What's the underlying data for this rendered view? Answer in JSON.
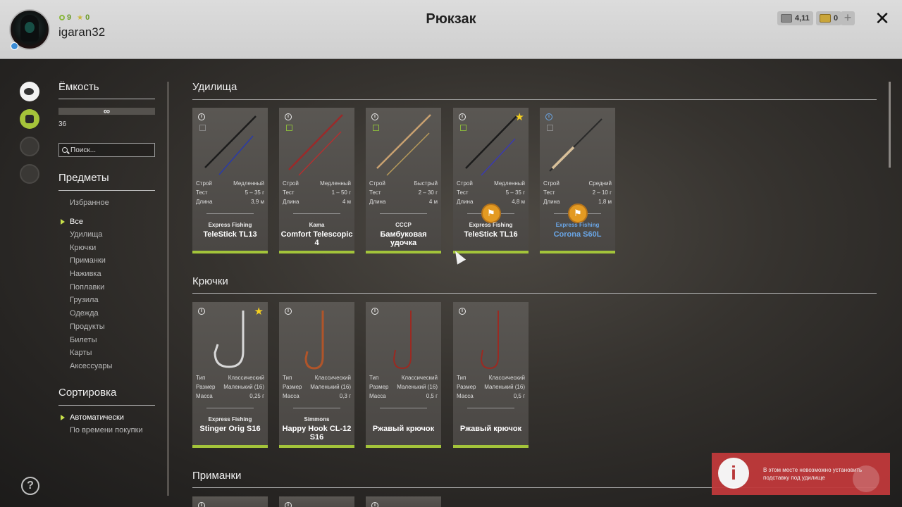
{
  "header": {
    "title": "Рюкзак",
    "username": "igaran32",
    "stat_level": "9",
    "stat_stars": "0",
    "silver": "4,11",
    "gold": "0",
    "add_label": "+",
    "close_label": "✕"
  },
  "sidebar": {
    "capacity_title": "Ёмкость",
    "capacity_value": "∞",
    "capacity_count": "36",
    "search_placeholder": "Поиск...",
    "items_title": "Предметы",
    "categories": [
      "Избранное",
      "Все",
      "Удилища",
      "Крючки",
      "Приманки",
      "Наживка",
      "Поплавки",
      "Грузила",
      "Одежда",
      "Продукты",
      "Билеты",
      "Карты",
      "Аксессуары"
    ],
    "active_category": "Все",
    "sort_title": "Сортировка",
    "sort_options": [
      "Автоматически",
      "По времени покупки"
    ],
    "active_sort": "Автоматически",
    "help_label": "?"
  },
  "sections": {
    "rods": {
      "title": "Удилища",
      "items": [
        {
          "brand": "Express Fishing",
          "name": "TeleStick TL13",
          "specs": [
            [
              "Строй",
              "Медленный"
            ],
            [
              "Тест",
              "5 – 35 г"
            ],
            [
              "Длина",
              "3,9 м"
            ]
          ]
        },
        {
          "brand": "Kama",
          "name": "Comfort Telescopic 4",
          "specs": [
            [
              "Строй",
              "Медленный"
            ],
            [
              "Тест",
              "1 – 50 г"
            ],
            [
              "Длина",
              "4 м"
            ]
          ]
        },
        {
          "brand": "СССР",
          "name": "Бамбуковая удочка",
          "specs": [
            [
              "Строй",
              "Быстрый"
            ],
            [
              "Тест",
              "2 – 30 г"
            ],
            [
              "Длина",
              "4 м"
            ]
          ]
        },
        {
          "brand": "Express Fishing",
          "name": "TeleStick TL16",
          "specs": [
            [
              "Строй",
              "Медленный"
            ],
            [
              "Тест",
              "5 – 35 г"
            ],
            [
              "Длина",
              "4,8 м"
            ]
          ]
        },
        {
          "brand": "Express Fishing",
          "name": "Corona S60L",
          "specs": [
            [
              "Строй",
              "Средний"
            ],
            [
              "Тест",
              "2 – 10 г"
            ],
            [
              "Длина",
              "1,8 м"
            ]
          ]
        }
      ]
    },
    "hooks": {
      "title": "Крючки",
      "items": [
        {
          "brand": "Express Fishing",
          "name": "Stinger Orig S16",
          "specs": [
            [
              "Тип",
              "Классический"
            ],
            [
              "Размер",
              "Маленький (16)"
            ],
            [
              "Масса",
              "0,25 г"
            ]
          ]
        },
        {
          "brand": "Simmons",
          "name": "Happy Hook CL-12 S16",
          "specs": [
            [
              "Тип",
              "Классический"
            ],
            [
              "Размер",
              "Маленький (16)"
            ],
            [
              "Масса",
              "0,3 г"
            ]
          ]
        },
        {
          "brand": "",
          "name": "Ржавый крючок",
          "specs": [
            [
              "Тип",
              "Классический"
            ],
            [
              "Размер",
              "Маленький (16)"
            ],
            [
              "Масса",
              "0,5 г"
            ]
          ]
        },
        {
          "brand": "",
          "name": "Ржавый крючок",
          "specs": [
            [
              "Тип",
              "Классический"
            ],
            [
              "Размер",
              "Маленький (16)"
            ],
            [
              "Масса",
              "0,5 г"
            ]
          ]
        }
      ]
    },
    "lures": {
      "title": "Приманки"
    }
  },
  "toast": {
    "icon": "i",
    "message": "В этом месте невозможно установить подставку под удилище"
  },
  "colors": {
    "accent": "#a3c43a",
    "favorite": "#f5d020",
    "link_blue": "#6aa6e6",
    "toast_bg": "#c0393b",
    "badge_orange": "#e39a22"
  },
  "icons": {
    "fish": "fish-icon",
    "backpack": "backpack-icon",
    "upgrade": "upgrade-icon",
    "home": "home-icon",
    "help": "help-icon",
    "silver_coin": "silver-coin-icon",
    "gold_coin": "gold-coin-icon",
    "close": "close-icon",
    "search": "search-icon",
    "info": "info-icon",
    "copy": "copy-icon",
    "star": "star-icon",
    "equip_badge": "equip-badge-icon"
  }
}
